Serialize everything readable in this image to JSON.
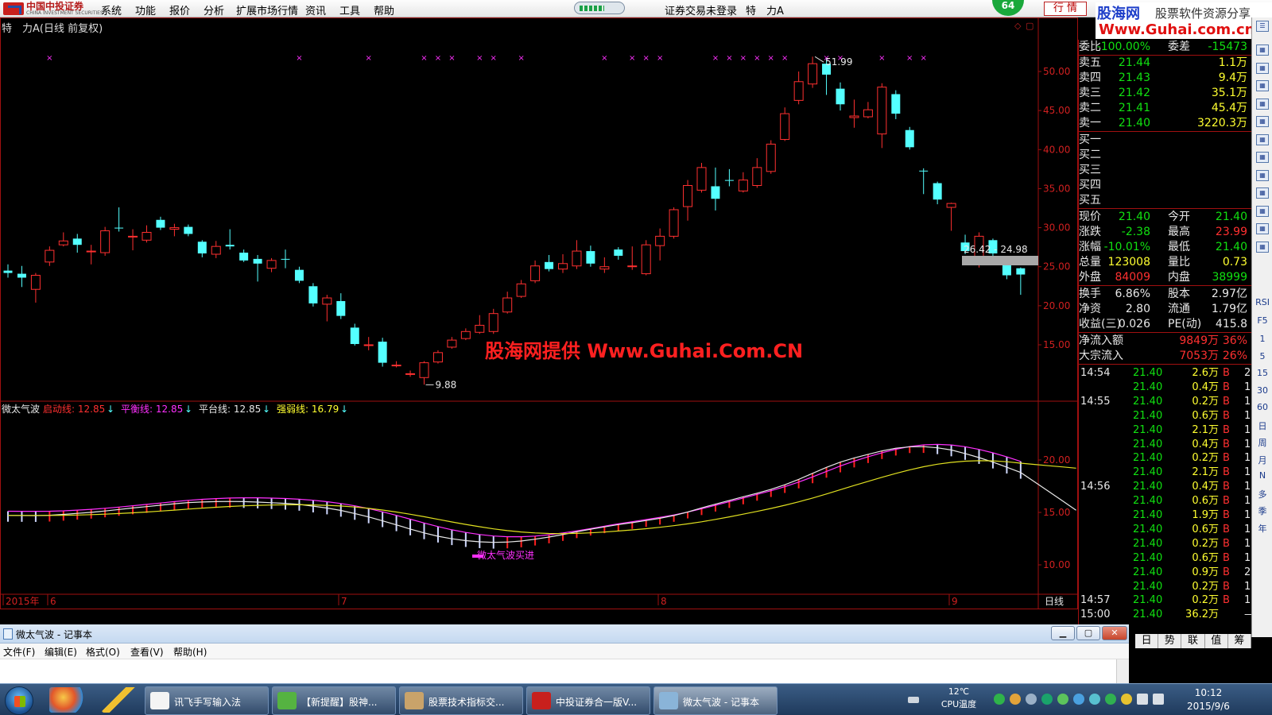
{
  "menubar": {
    "logo_name": "中国中投证券",
    "logo_sub": "CHINA INVESTMENT SECURITIES",
    "items": [
      "系统",
      "功能",
      "报价",
      "分析",
      "扩展市场行情",
      "资讯",
      "工具",
      "帮助"
    ],
    "login_status": "证券交易未登录",
    "stock_title": "特　力A",
    "badge": "64",
    "quote_button": "行 情",
    "progress_percent": 60
  },
  "watermark": {
    "site": "股海网",
    "tagline": "股票软件资源分享",
    "url": "Www.Guhai.com.cn"
  },
  "chart": {
    "title": "特　力A(日线 前复权)",
    "center_watermark": "股海网提供 Www.Guhai.Com.CN",
    "price_axis": [
      "50.00",
      "45.00",
      "40.00",
      "35.00",
      "30.00",
      "25.00",
      "20.00",
      "15.00"
    ],
    "high_label": "51.99",
    "low_label": "9.88",
    "range_label": "26.42 - 24.98",
    "indicator_title": "微太气波",
    "indicator_lines": [
      {
        "label": "启动线: 12.85",
        "color": "#ff3030"
      },
      {
        "label": "平衡线: 12.85",
        "color": "#ff30ff"
      },
      {
        "label": "平台线: 12.85",
        "color": "#e8e8e8"
      },
      {
        "label": "强弱线: 16.79",
        "color": "#ffff30"
      }
    ],
    "indicator_axis": [
      "20.00",
      "15.00",
      "10.00"
    ],
    "buy_label": "微太气波买进",
    "date_axis": [
      "2015年",
      "6",
      "7",
      "8",
      "9"
    ],
    "period_label": "日线"
  },
  "chart_data": {
    "type": "candlestick",
    "ylim": [
      5,
      55
    ],
    "candles": [
      [
        24.5,
        24.2,
        25.3,
        23.6
      ],
      [
        24.1,
        23.6,
        25.1,
        22.4
      ],
      [
        22.1,
        23.9,
        24.2,
        20.4
      ],
      [
        25.6,
        27.1,
        27.6,
        25.1
      ],
      [
        27.8,
        28.3,
        29.4,
        27.6
      ],
      [
        28.6,
        27.8,
        29.2,
        26.8
      ],
      [
        27.0,
        27.0,
        27.8,
        25.3
      ],
      [
        26.8,
        29.6,
        30.1,
        26.4
      ],
      [
        30.0,
        29.9,
        32.6,
        29.5
      ],
      [
        28.9,
        28.9,
        29.8,
        27.1
      ],
      [
        28.4,
        29.4,
        30.3,
        28.1
      ],
      [
        31.0,
        30.0,
        31.4,
        29.7
      ],
      [
        29.8,
        30.0,
        30.5,
        28.9
      ],
      [
        30.1,
        29.2,
        30.4,
        28.9
      ],
      [
        28.2,
        26.7,
        28.4,
        26.2
      ],
      [
        26.6,
        27.6,
        28.3,
        26.1
      ],
      [
        27.8,
        27.6,
        29.8,
        27.2
      ],
      [
        26.8,
        25.8,
        27.2,
        25.6
      ],
      [
        26.0,
        25.4,
        26.5,
        23.1
      ],
      [
        24.8,
        25.8,
        26.1,
        24.3
      ],
      [
        26.0,
        25.9,
        27.2,
        24.8
      ],
      [
        24.6,
        23.2,
        25.0,
        22.9
      ],
      [
        22.5,
        20.3,
        22.9,
        19.9
      ],
      [
        20.2,
        21.0,
        21.4,
        18.0
      ],
      [
        20.6,
        18.7,
        21.6,
        18.3
      ],
      [
        17.2,
        15.1,
        17.7,
        14.9
      ],
      [
        15.0,
        15.0,
        16.0,
        14.3
      ],
      [
        15.4,
        12.7,
        15.9,
        12.2
      ],
      [
        12.4,
        12.4,
        12.9,
        12.1
      ],
      [
        11.3,
        11.3,
        11.7,
        10.9
      ],
      [
        10.8,
        12.7,
        12.9,
        9.9
      ],
      [
        12.8,
        14.0,
        14.3,
        12.6
      ],
      [
        14.7,
        15.6,
        16.0,
        14.5
      ],
      [
        15.8,
        16.7,
        17.1,
        15.6
      ],
      [
        16.6,
        17.5,
        18.8,
        16.4
      ],
      [
        16.7,
        19.0,
        19.6,
        16.4
      ],
      [
        19.2,
        21.0,
        21.8,
        19.0
      ],
      [
        21.2,
        22.8,
        23.3,
        21.0
      ],
      [
        23.2,
        25.1,
        25.8,
        22.9
      ],
      [
        25.6,
        24.7,
        26.5,
        24.4
      ],
      [
        24.7,
        25.4,
        26.6,
        24.2
      ],
      [
        25.1,
        27.0,
        28.4,
        24.7
      ],
      [
        27.0,
        25.4,
        27.7,
        25.0
      ],
      [
        24.7,
        25.0,
        26.2,
        24.2
      ],
      [
        27.2,
        26.4,
        27.5,
        25.9
      ],
      [
        25.1,
        25.1,
        27.6,
        24.6
      ],
      [
        24.1,
        27.8,
        28.4,
        23.9
      ],
      [
        27.7,
        28.9,
        29.9,
        25.8
      ],
      [
        28.9,
        32.3,
        32.6,
        28.6
      ],
      [
        32.7,
        35.4,
        36.1,
        30.9
      ],
      [
        34.8,
        37.7,
        38.3,
        34.5
      ],
      [
        35.3,
        33.7,
        37.7,
        32.2
      ],
      [
        36.1,
        36.0,
        37.5,
        35.3
      ],
      [
        34.7,
        36.1,
        37.1,
        34.5
      ],
      [
        35.4,
        37.7,
        38.9,
        35.1
      ],
      [
        37.2,
        40.7,
        41.2,
        36.9
      ],
      [
        41.3,
        44.6,
        45.4,
        41.1
      ],
      [
        46.3,
        48.7,
        50.0,
        45.8
      ],
      [
        48.4,
        51.0,
        51.9,
        47.9
      ],
      [
        51.0,
        49.6,
        51.6,
        47.0
      ],
      [
        47.8,
        45.8,
        48.6,
        45.0
      ],
      [
        44.1,
        44.3,
        46.4,
        42.8
      ],
      [
        44.2,
        45.1,
        46.1,
        44.0
      ],
      [
        42.0,
        48.0,
        48.5,
        40.2
      ],
      [
        47.1,
        44.6,
        47.6,
        43.9
      ],
      [
        42.5,
        40.3,
        42.9,
        40.0
      ],
      [
        37.3,
        37.2,
        37.6,
        34.3
      ],
      [
        35.7,
        33.6,
        35.9,
        33.0
      ],
      [
        32.6,
        33.1,
        33.2,
        29.6
      ],
      [
        28.1,
        27.0,
        29.1,
        26.6
      ],
      [
        25.8,
        28.9,
        29.4,
        24.9
      ],
      [
        28.4,
        26.7,
        28.6,
        26.3
      ],
      [
        25.4,
        23.9,
        25.6,
        23.4
      ],
      [
        24.8,
        24.0,
        24.9,
        21.4
      ]
    ],
    "indicator": {
      "series": [
        "启动线",
        "平衡线",
        "平台线",
        "强弱线"
      ],
      "ylim": [
        5,
        25
      ]
    }
  },
  "quote": {
    "top": {
      "label": "委比",
      "value": "-100.00%",
      "label2": "委差",
      "value2": "-15473"
    },
    "sell": [
      {
        "label": "卖五",
        "price": "21.44",
        "vol": "1.1万"
      },
      {
        "label": "卖四",
        "price": "21.43",
        "vol": "9.4万"
      },
      {
        "label": "卖三",
        "price": "21.42",
        "vol": "35.1万"
      },
      {
        "label": "卖二",
        "price": "21.41",
        "vol": "45.4万"
      },
      {
        "label": "卖一",
        "price": "21.40",
        "vol": "3220.3万"
      }
    ],
    "buy": [
      "买一",
      "买二",
      "买三",
      "买四",
      "买五"
    ],
    "stats": [
      {
        "l1": "现价",
        "v1": "21.40",
        "c1": "grn",
        "l2": "今开",
        "v2": "21.40",
        "c2": "grn"
      },
      {
        "l1": "涨跌",
        "v1": "-2.38",
        "c1": "grn",
        "l2": "最高",
        "v2": "23.99",
        "c2": "red"
      },
      {
        "l1": "涨幅",
        "v1": "-10.01%",
        "c1": "grn",
        "l2": "最低",
        "v2": "21.40",
        "c2": "grn"
      },
      {
        "l1": "总量",
        "v1": "123008",
        "c1": "yel",
        "l2": "量比",
        "v2": "0.73",
        "c2": "yel"
      },
      {
        "l1": "外盘",
        "v1": "84009",
        "c1": "red",
        "l2": "内盘",
        "v2": "38999",
        "c2": "grn"
      },
      {
        "l1": "换手",
        "v1": "6.86%",
        "c1": "wht",
        "l2": "股本",
        "v2": "2.97亿",
        "c2": "wht"
      },
      {
        "l1": "净资",
        "v1": "2.80",
        "c1": "wht",
        "l2": "流通",
        "v2": "1.79亿",
        "c2": "wht"
      },
      {
        "l1": "收益(三)",
        "v1": "0.026",
        "c1": "wht",
        "l2": "PE(动)",
        "v2": "415.8",
        "c2": "wht"
      }
    ],
    "flows": [
      {
        "label": "净流入额",
        "value": "9849万",
        "pct": "36%"
      },
      {
        "label": "大宗流入",
        "value": "7053万",
        "pct": "26%"
      }
    ],
    "ticks": [
      {
        "time": "14:54",
        "price": "21.40",
        "vol": "2.6万",
        "side": "B",
        "cnt": "2"
      },
      {
        "time": "",
        "price": "21.40",
        "vol": "0.4万",
        "side": "B",
        "cnt": "1"
      },
      {
        "time": "14:55",
        "price": "21.40",
        "vol": "0.2万",
        "side": "B",
        "cnt": "1"
      },
      {
        "time": "",
        "price": "21.40",
        "vol": "0.6万",
        "side": "B",
        "cnt": "1"
      },
      {
        "time": "",
        "price": "21.40",
        "vol": "2.1万",
        "side": "B",
        "cnt": "1"
      },
      {
        "time": "",
        "price": "21.40",
        "vol": "0.4万",
        "side": "B",
        "cnt": "1"
      },
      {
        "time": "",
        "price": "21.40",
        "vol": "0.2万",
        "side": "B",
        "cnt": "1"
      },
      {
        "time": "",
        "price": "21.40",
        "vol": "2.1万",
        "side": "B",
        "cnt": "1"
      },
      {
        "time": "14:56",
        "price": "21.40",
        "vol": "0.4万",
        "side": "B",
        "cnt": "1"
      },
      {
        "time": "",
        "price": "21.40",
        "vol": "0.6万",
        "side": "B",
        "cnt": "1"
      },
      {
        "time": "",
        "price": "21.40",
        "vol": "1.9万",
        "side": "B",
        "cnt": "1"
      },
      {
        "time": "",
        "price": "21.40",
        "vol": "0.6万",
        "side": "B",
        "cnt": "1"
      },
      {
        "time": "",
        "price": "21.40",
        "vol": "0.2万",
        "side": "B",
        "cnt": "1"
      },
      {
        "time": "",
        "price": "21.40",
        "vol": "0.6万",
        "side": "B",
        "cnt": "1"
      },
      {
        "time": "",
        "price": "21.40",
        "vol": "0.9万",
        "side": "B",
        "cnt": "2"
      },
      {
        "time": "",
        "price": "21.40",
        "vol": "0.2万",
        "side": "B",
        "cnt": "1"
      },
      {
        "time": "14:57",
        "price": "21.40",
        "vol": "0.2万",
        "side": "B",
        "cnt": "1"
      },
      {
        "time": "15:00",
        "price": "21.40",
        "vol": "36.2万",
        "side": "",
        "cnt": "—"
      }
    ],
    "tabs": [
      "日",
      "势",
      "联",
      "值",
      "筹"
    ]
  },
  "right_toolbar": [
    "RSI",
    "F5",
    "1",
    "5",
    "15",
    "30",
    "60",
    "日",
    "周",
    "月",
    "N",
    "多",
    "季",
    "年"
  ],
  "notepad": {
    "title": "微太气波 - 记事本",
    "menus": [
      "文件(F)",
      "编辑(E)",
      "格式(O)",
      "查看(V)",
      "帮助(H)"
    ]
  },
  "taskbar": {
    "tasks": [
      {
        "label": "讯飞手写输入法",
        "color": "#f4f4f4"
      },
      {
        "label": "【新提醒】股神...",
        "color": "#55b341"
      },
      {
        "label": "股票技术指标交...",
        "color": "#c9a36a"
      },
      {
        "label": "中投证券合一版V...",
        "color": "#c8201d"
      },
      {
        "label": "微太气波 - 记事本",
        "color": "#8ab4d8"
      }
    ],
    "temp": "12℃",
    "temp_label": "CPU温度",
    "time": "10:12",
    "date": "2015/9/6"
  }
}
